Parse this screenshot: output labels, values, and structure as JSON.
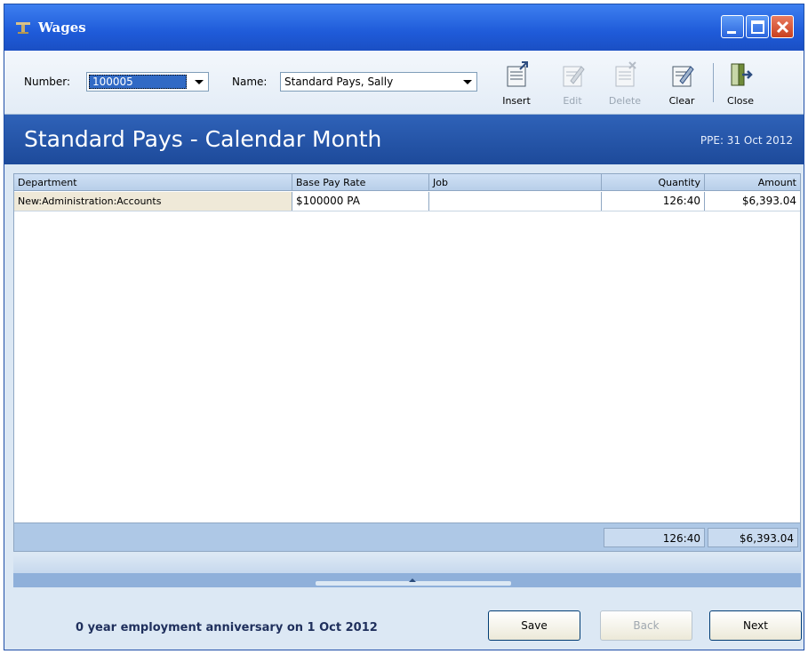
{
  "window": {
    "title": "Wages"
  },
  "toolbar": {
    "number_label": "Number:",
    "number_value": "100005",
    "name_label": "Name:",
    "name_value": "Standard Pays, Sally",
    "buttons": {
      "insert": "Insert",
      "edit": "Edit",
      "delete": "Delete",
      "clear": "Clear",
      "close": "Close"
    }
  },
  "banner": {
    "title": "Standard Pays - Calendar Month",
    "ppe": "PPE: 31 Oct 2012"
  },
  "grid": {
    "headers": [
      "Department",
      "Base Pay Rate",
      "Job",
      "Quantity",
      "Amount"
    ],
    "rows": [
      [
        "New:Administration:Accounts",
        "$100000 PA",
        "",
        "126:40",
        "$6,393.04"
      ]
    ],
    "totals": {
      "quantity": "126:40",
      "amount": "$6,393.04"
    }
  },
  "footer": {
    "anniversary": "0 year employment anniversary on 1 Oct 2012",
    "save": "Save",
    "back": "Back",
    "next": "Next"
  },
  "colors": {
    "titlebar": "#1f5bd9",
    "banner": "#2f62b8",
    "close_button": "#c9401f"
  }
}
